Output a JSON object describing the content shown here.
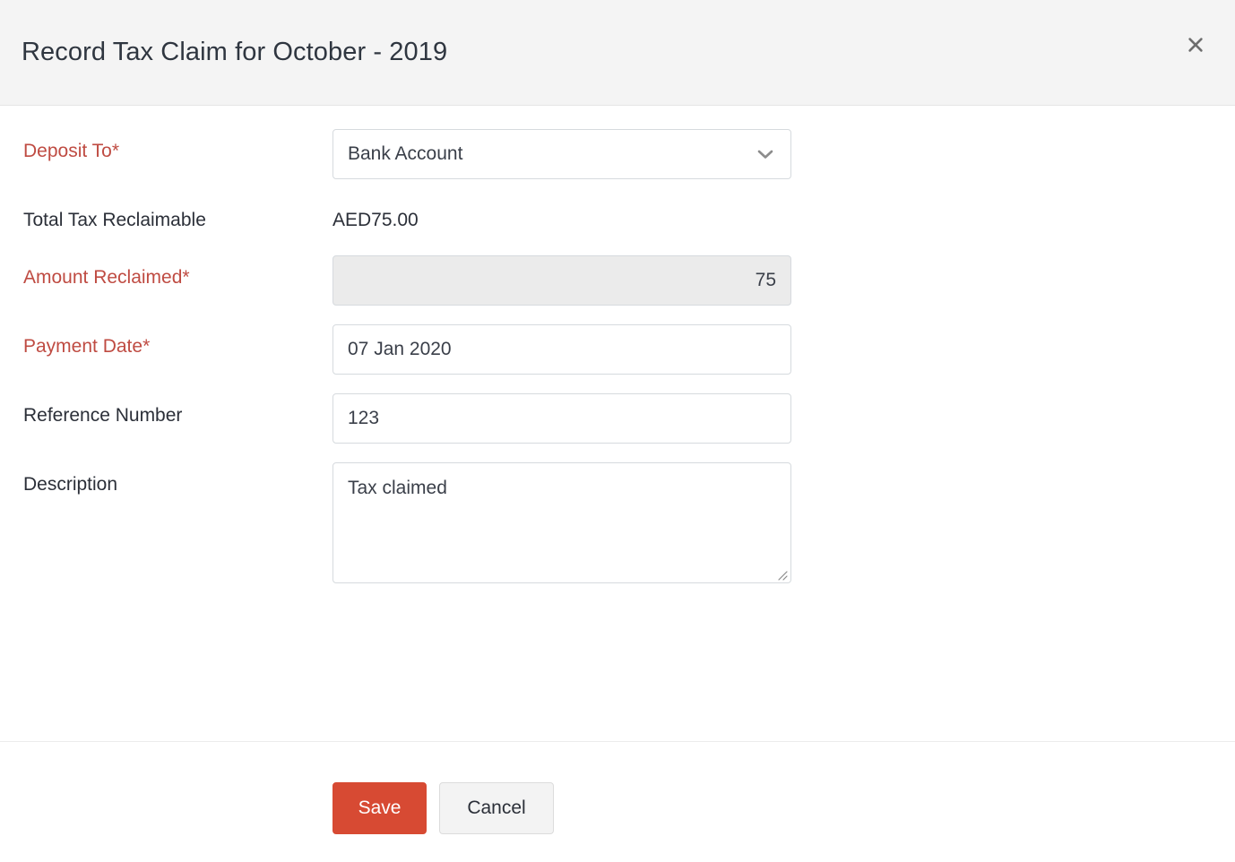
{
  "header": {
    "title": "Record Tax Claim for October - 2019",
    "close_icon": "close-icon"
  },
  "form": {
    "deposit_to": {
      "label": "Deposit To*",
      "required": true,
      "value": "Bank Account",
      "dropdown_icon": "chevron-down-icon"
    },
    "total_tax_reclaimable": {
      "label": "Total Tax Reclaimable",
      "required": false,
      "value": "AED75.00"
    },
    "amount_reclaimed": {
      "label": "Amount Reclaimed*",
      "required": true,
      "value": "75",
      "disabled": true
    },
    "payment_date": {
      "label": "Payment Date*",
      "required": true,
      "value": "07 Jan 2020"
    },
    "reference_number": {
      "label": "Reference Number",
      "required": false,
      "value": "123"
    },
    "description": {
      "label": "Description",
      "required": false,
      "value": "Tax claimed"
    }
  },
  "footer": {
    "save_label": "Save",
    "cancel_label": "Cancel"
  },
  "colors": {
    "accent_red": "#d74a33",
    "required_label": "#bf4b42",
    "header_bg": "#f4f4f4",
    "disabled_bg": "#ebebeb",
    "border": "#d6dade",
    "text": "#2b2f38"
  }
}
